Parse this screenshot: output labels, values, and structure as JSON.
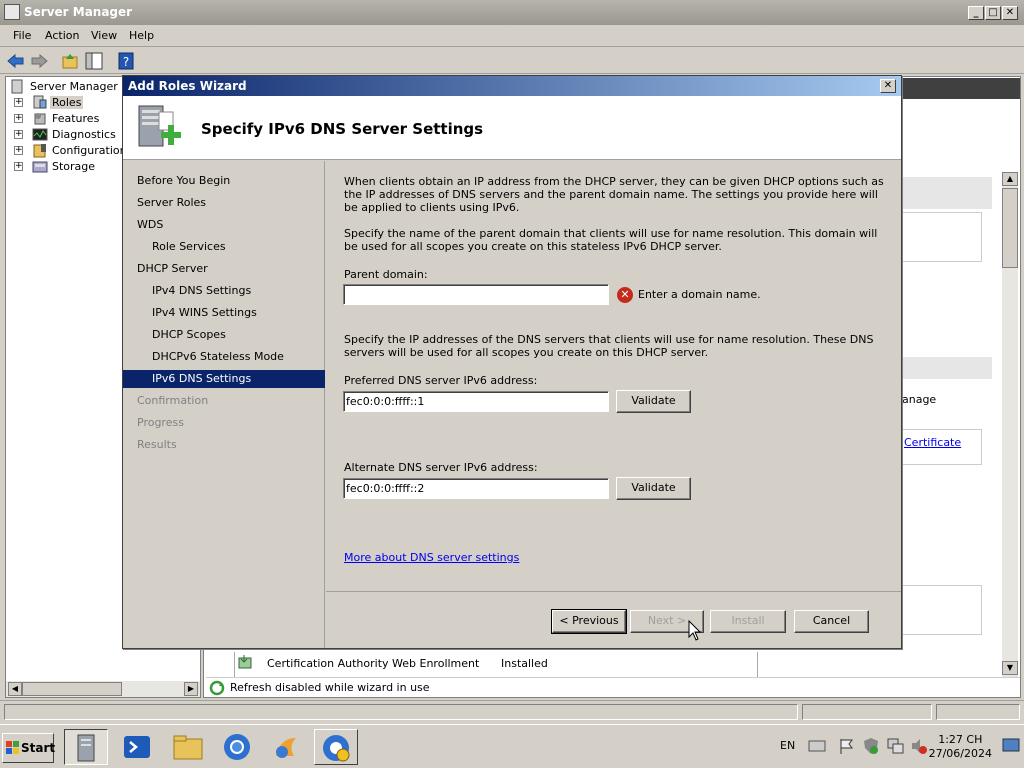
{
  "window": {
    "title": "Server Manager"
  },
  "menu": [
    "File",
    "Action",
    "View",
    "Help"
  ],
  "tree": {
    "root": "Server Manager (W",
    "items": [
      "Roles",
      "Features",
      "Diagnostics",
      "Configuration",
      "Storage"
    ]
  },
  "background": {
    "manage_text": "anage",
    "certificate_link": "Certificate",
    "row_name": "Certification Authority Web Enrollment",
    "row_status": "Installed",
    "status_message": "Refresh disabled while wizard in use"
  },
  "wizard": {
    "title": "Add Roles Wizard",
    "heading": "Specify IPv6 DNS Server Settings",
    "nav": [
      {
        "label": "Before You Begin",
        "level": "top",
        "state": "normal"
      },
      {
        "label": "Server Roles",
        "level": "top",
        "state": "normal"
      },
      {
        "label": "WDS",
        "level": "top",
        "state": "normal"
      },
      {
        "label": "Role Services",
        "level": "sub",
        "state": "normal"
      },
      {
        "label": "DHCP Server",
        "level": "top",
        "state": "normal"
      },
      {
        "label": "IPv4 DNS Settings",
        "level": "sub",
        "state": "normal"
      },
      {
        "label": "IPv4 WINS Settings",
        "level": "sub",
        "state": "normal"
      },
      {
        "label": "DHCP Scopes",
        "level": "sub",
        "state": "normal"
      },
      {
        "label": "DHCPv6 Stateless Mode",
        "level": "sub",
        "state": "normal"
      },
      {
        "label": "IPv6 DNS Settings",
        "level": "sub",
        "state": "active"
      },
      {
        "label": "Confirmation",
        "level": "top",
        "state": "disabled"
      },
      {
        "label": "Progress",
        "level": "top",
        "state": "disabled"
      },
      {
        "label": "Results",
        "level": "top",
        "state": "disabled"
      }
    ],
    "intro": "When clients obtain an IP address from the DHCP server, they can be given DHCP options such as the IP addresses of DNS servers and the parent domain name. The settings you provide here will be applied to clients using IPv6.",
    "parent_domain_desc": "Specify the name of the parent domain that clients will use for name resolution. This domain will be used for all scopes you create on this stateless IPv6 DHCP server.",
    "parent_domain_label": "Parent domain:",
    "parent_domain_value": "",
    "parent_domain_error": "Enter a domain name.",
    "dns_desc": "Specify the IP addresses of the DNS servers that clients will use for name resolution. These DNS servers will be used for all scopes you create on this DHCP server.",
    "preferred_label": "Preferred DNS server IPv6 address:",
    "preferred_value": "fec0:0:0:ffff::1",
    "alternate_label": "Alternate DNS server IPv6 address:",
    "alternate_value": "fec0:0:0:ffff::2",
    "validate_label": "Validate",
    "more_link": "More about DNS server settings",
    "buttons": {
      "previous": "< Previous",
      "next": "Next >",
      "install": "Install",
      "cancel": "Cancel"
    }
  },
  "taskbar": {
    "start": "Start",
    "language": "EN",
    "time": "1:27 CH",
    "date": "27/06/2024"
  }
}
